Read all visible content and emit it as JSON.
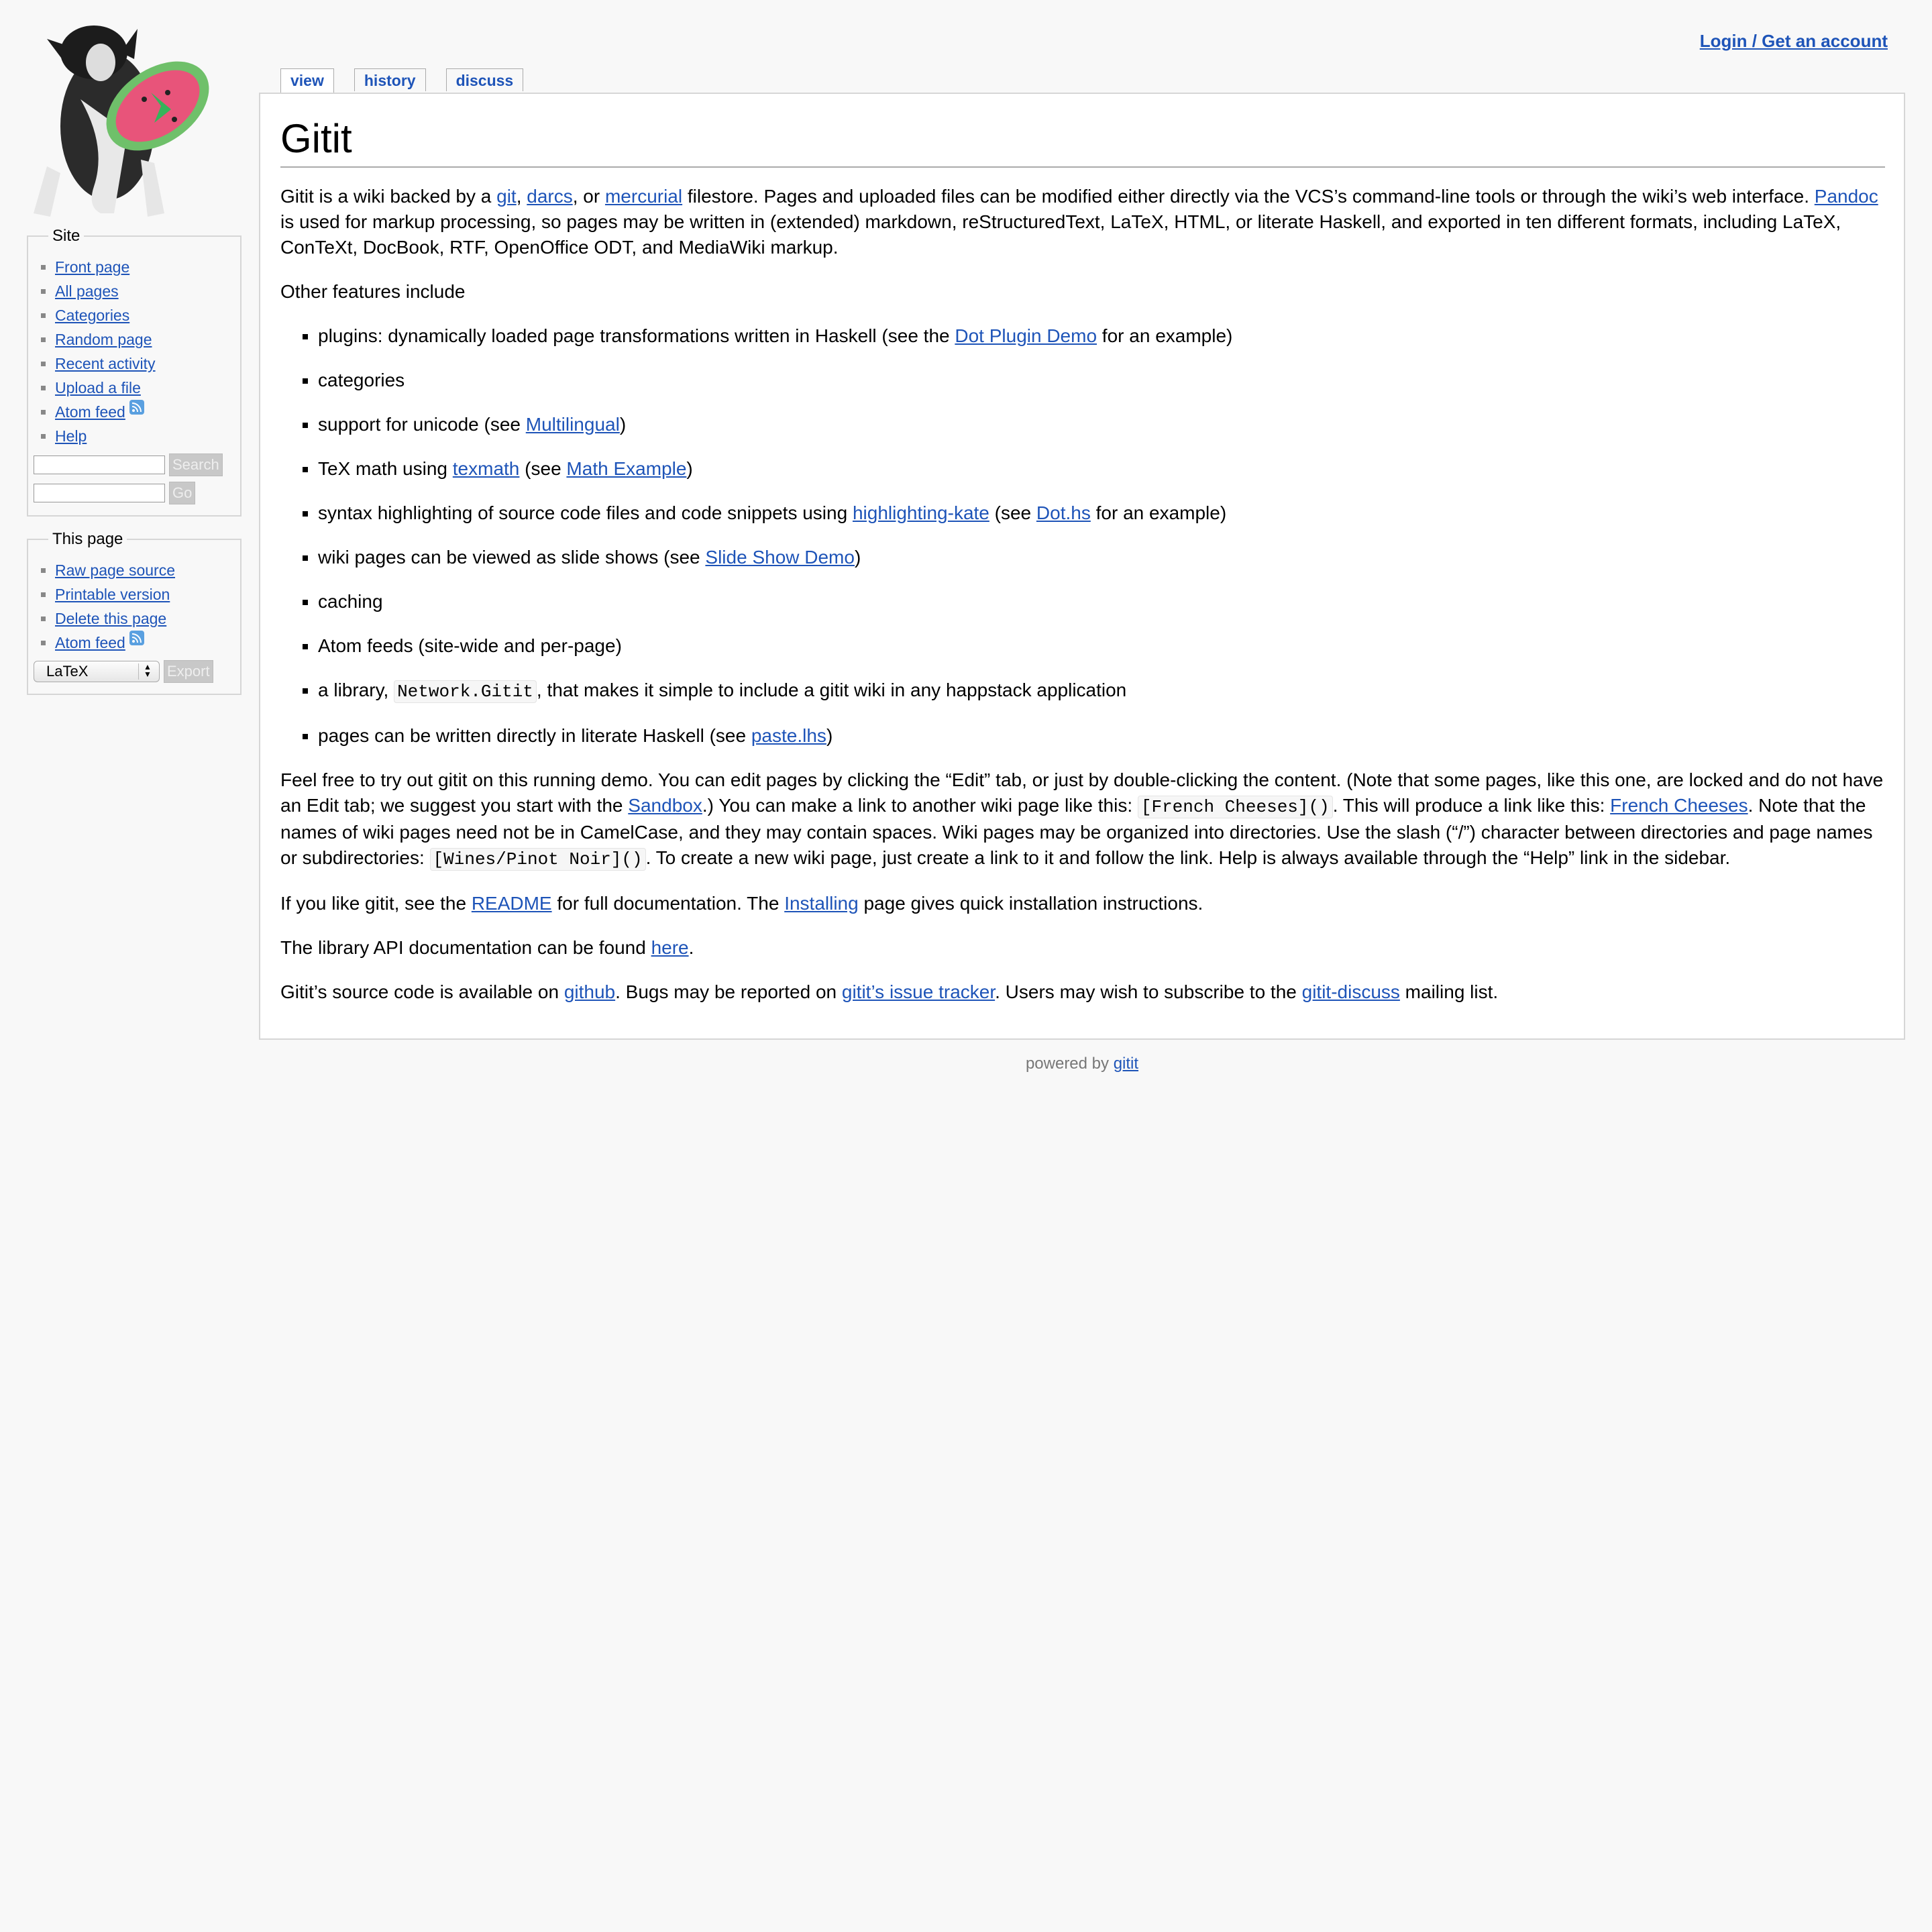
{
  "header": {
    "login_label": "Login / Get an account"
  },
  "tabs": [
    {
      "label": "view",
      "active": true
    },
    {
      "label": "history",
      "active": false
    },
    {
      "label": "discuss",
      "active": false
    }
  ],
  "sidebar": {
    "site": {
      "legend": "Site",
      "items": [
        "Front page",
        "All pages",
        "Categories",
        "Random page",
        "Recent activity",
        "Upload a file",
        "Atom feed",
        "Help"
      ],
      "search_button": "Search",
      "go_button": "Go"
    },
    "this_page": {
      "legend": "This page",
      "items": [
        "Raw page source",
        "Printable version",
        "Delete this page",
        "Atom feed"
      ],
      "format_selected": "LaTeX",
      "export_button": "Export"
    }
  },
  "page": {
    "title": "Gitit",
    "intro": {
      "t1": "Gitit is a wiki backed by a ",
      "l_git": "git",
      "t2": ", ",
      "l_darcs": "darcs",
      "t3": ", or ",
      "l_mercurial": "mercurial",
      "t4": " filestore. Pages and uploaded files can be modified either directly via the VCS’s command-line tools or through the wiki’s web interface. ",
      "l_pandoc": "Pandoc",
      "t5": " is used for markup processing, so pages may be written in (extended) markdown, reStructuredText, LaTeX, HTML, or literate Haskell, and exported in ten different formats, including LaTeX, ConTeXt, DocBook, RTF, OpenOffice ODT, and MediaWiki markup."
    },
    "other_features": "Other features include",
    "features": {
      "f1a": "plugins: dynamically loaded page transformations written in Haskell (see the ",
      "f1l": "Dot Plugin Demo",
      "f1b": " for an example)",
      "f2": "categories",
      "f3a": "support for unicode (see ",
      "f3l": "Multilingual",
      "f3b": ")",
      "f4a": "TeX math using ",
      "f4l1": "texmath",
      "f4b": " (see ",
      "f4l2": "Math Example",
      "f4c": ")",
      "f5a": "syntax highlighting of source code files and code snippets using ",
      "f5l1": "highlighting-kate",
      "f5b": " (see ",
      "f5l2": "Dot.hs",
      "f5c": " for an example)",
      "f6a": "wiki pages can be viewed as slide shows (see ",
      "f6l": "Slide Show Demo",
      "f6b": ")",
      "f7": "caching",
      "f8": "Atom feeds (site-wide and per-page)",
      "f9a": "a library, ",
      "f9code": "Network.Gitit",
      "f9b": ", that makes it simple to include a gitit wiki in any happstack application",
      "f10a": "pages can be written directly in literate Haskell (see ",
      "f10l": "paste.lhs",
      "f10b": ")"
    },
    "feel_free": {
      "t1": "Feel free to try out gitit on this running demo. You can edit pages by clicking the “Edit” tab, or just by double-clicking the content. (Note that some pages, like this one, are locked and do not have an Edit tab; we suggest you start with the ",
      "l_sandbox": "Sandbox",
      "t2": ".) You can make a link to another wiki page like this: ",
      "code1": "[French Cheeses]()",
      "t3": ". This will produce a link like this: ",
      "l_cheeses": "French Cheeses",
      "t4": ". Note that the names of wiki pages need not be in CamelCase, and they may contain spaces. Wiki pages may be organized into directories. Use the slash (“/”) character between directories and page names or subdirectories: ",
      "code2": "[Wines/Pinot Noir]()",
      "t5": ". To create a new wiki page, just create a link to it and follow the link. Help is always available through the “Help” link in the sidebar."
    },
    "readme": {
      "t1": "If you like gitit, see the ",
      "l_readme": "README",
      "t2": " for full documentation. The ",
      "l_installing": "Installing",
      "t3": " page gives quick installation instructions."
    },
    "api": {
      "t1": "The library API documentation can be found ",
      "l_here": "here",
      "t2": "."
    },
    "source": {
      "t1": "Gitit’s source code is available on ",
      "l_github": "github",
      "t2": ". Bugs may be reported on ",
      "l_tracker": "gitit’s issue tracker",
      "t3": ". Users may wish to subscribe to the ",
      "l_discuss": "gitit-discuss",
      "t4": " mailing list."
    }
  },
  "footer": {
    "text": "powered by ",
    "link": "gitit"
  },
  "icons": {
    "logo": "dog-with-frisbee-logo",
    "feed": "rss-feed-icon"
  },
  "colors": {
    "link": "#1e54b8",
    "background": "#f8f8f8",
    "content_bg": "#ffffff"
  }
}
